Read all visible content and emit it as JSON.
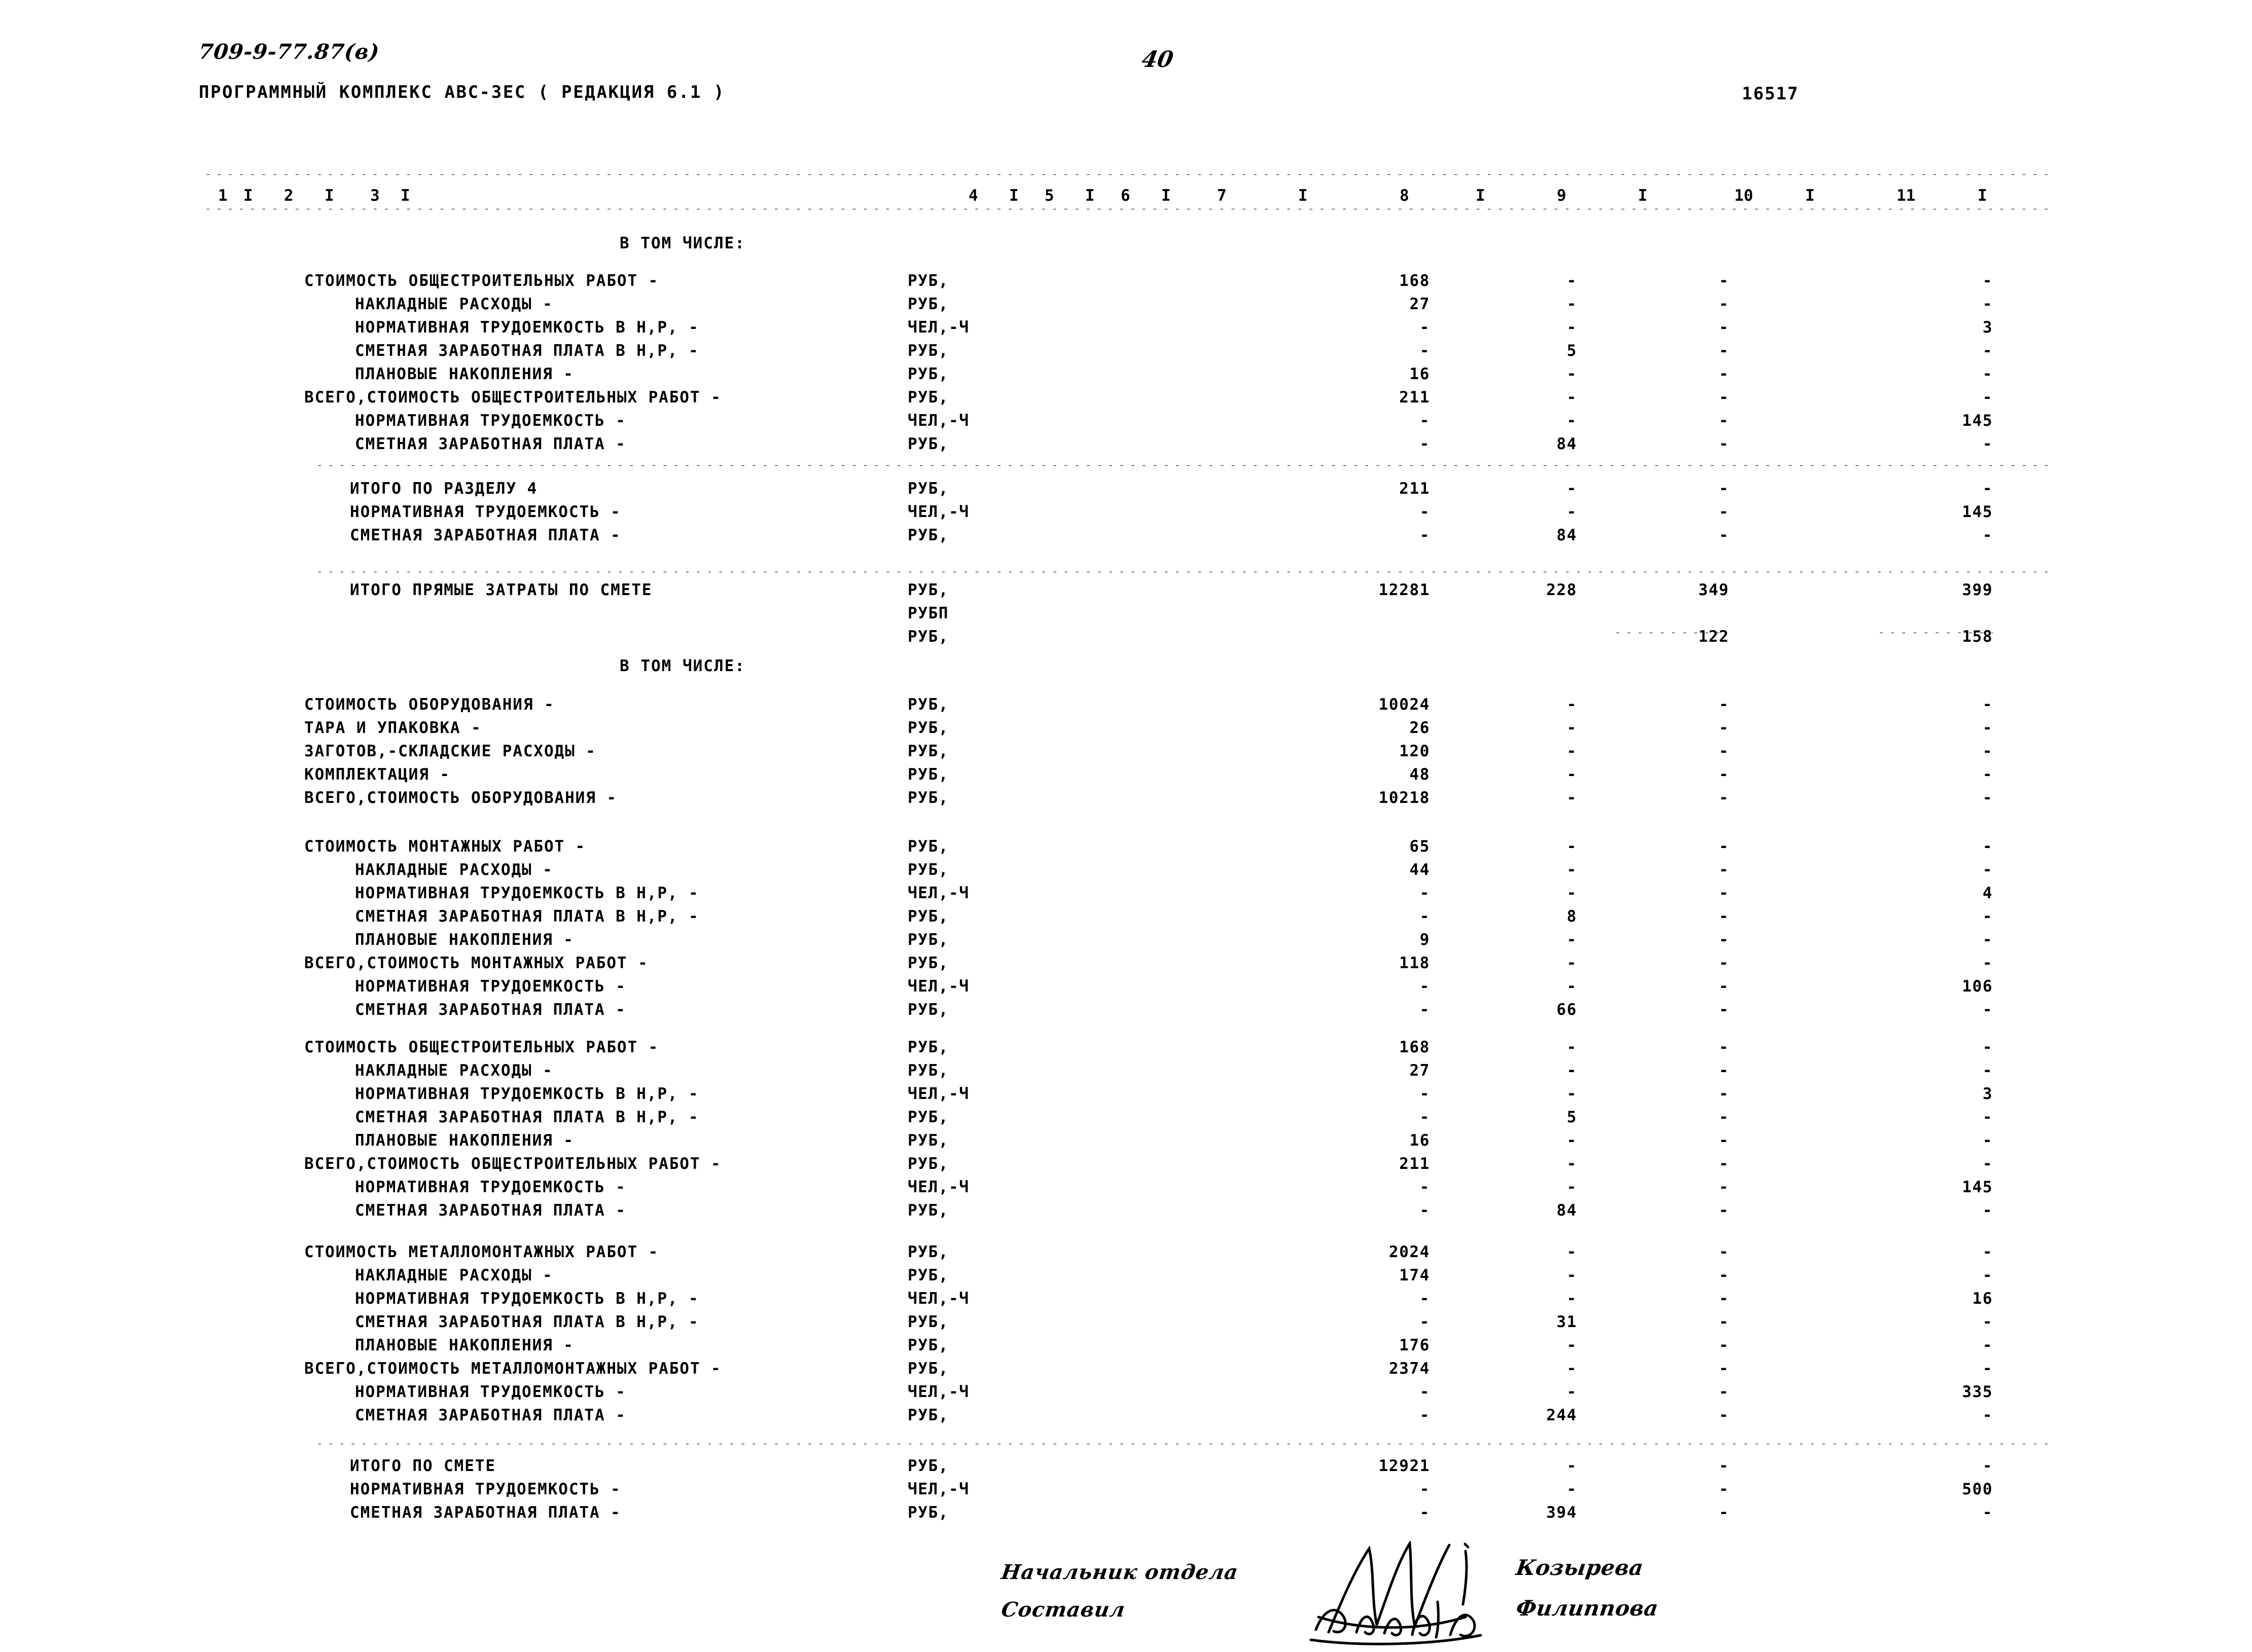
{
  "header": {
    "doc_code": "709-9-77.87(в)",
    "program_line": "ПРОГРАММНЫЙ КОМПЛЕКС АВС-ЗЕС    ( РЕДАКЦИЯ  6.1 )",
    "page_number": "40",
    "doc_id": "16517"
  },
  "column_header": {
    "numbers": [
      "1",
      "2",
      "3",
      "4",
      "5",
      "6",
      "7",
      "8",
      "9",
      "10",
      "11"
    ],
    "separator": "I"
  },
  "section_titles": {
    "in_that_number_1": "В ТОМ ЧИСЛЕ:",
    "in_that_number_2": "В ТОМ ЧИСЛЕ:"
  },
  "units": {
    "rub": "РУБ,",
    "chel_ch": "ЧЕЛ,-Ч"
  },
  "dash": "-",
  "rows": [
    {
      "label": "СТОИМОСТЬ ОБЩЕСТРОИТЕЛЬНЫХ РАБОТ -",
      "indent": 0,
      "unit": "РУБ,",
      "c7": "168",
      "c8": "-",
      "c9": "-",
      "c10": "",
      "c11": "-"
    },
    {
      "label": "НАКЛАДНЫЕ РАСХОДЫ -",
      "indent": 1,
      "unit": "РУБ,",
      "c7": "27",
      "c8": "-",
      "c9": "-",
      "c10": "",
      "c11": "-"
    },
    {
      "label": "НОРМАТИВНАЯ ТРУДОЕМКОСТЬ В Н,Р, -",
      "indent": 1,
      "unit": "ЧЕЛ,-Ч",
      "c7": "-",
      "c8": "-",
      "c9": "-",
      "c10": "",
      "c11": "3"
    },
    {
      "label": "СМЕТНАЯ ЗАРАБОТНАЯ ПЛАТА В Н,Р, -",
      "indent": 1,
      "unit": "РУБ,",
      "c7": "-",
      "c8": "5",
      "c9": "-",
      "c10": "",
      "c11": "-"
    },
    {
      "label": "ПЛАНОВЫЕ НАКОПЛЕНИЯ -",
      "indent": 1,
      "unit": "РУБ,",
      "c7": "16",
      "c8": "-",
      "c9": "-",
      "c10": "",
      "c11": "-"
    },
    {
      "label": "ВСЕГО,СТОИМОСТЬ ОБЩЕСТРОИТЕЛЬНЫХ РАБОТ -",
      "indent": 0,
      "unit": "РУБ,",
      "c7": "211",
      "c8": "-",
      "c9": "-",
      "c10": "",
      "c11": "-"
    },
    {
      "label": "НОРМАТИВНАЯ ТРУДОЕМКОСТЬ -",
      "indent": 1,
      "unit": "ЧЕЛ,-Ч",
      "c7": "-",
      "c8": "-",
      "c9": "-",
      "c10": "",
      "c11": "145"
    },
    {
      "label": "СМЕТНАЯ ЗАРАБОТНАЯ ПЛАТА -",
      "indent": 1,
      "unit": "РУБ,",
      "c7": "-",
      "c8": "84",
      "c9": "-",
      "c10": "",
      "c11": "-"
    }
  ],
  "razdel_rows": [
    {
      "label": "ИТОГО ПО РАЗДЕЛУ     4",
      "indent": 2,
      "unit": "РУБ,",
      "c7": "211",
      "c8": "-",
      "c9": "-",
      "c10": "",
      "c11": "-"
    },
    {
      "label": "НОРМАТИВНАЯ ТРУДОЕМКОСТЬ -",
      "indent": 2,
      "unit": "ЧЕЛ,-Ч",
      "c7": "-",
      "c8": "-",
      "c9": "-",
      "c10": "",
      "c11": "145"
    },
    {
      "label": "СМЕТНАЯ ЗАРАБОТНАЯ ПЛАТА -",
      "indent": 2,
      "unit": "РУБ,",
      "c7": "-",
      "c8": "84",
      "c9": "-",
      "c10": "",
      "c11": "-"
    }
  ],
  "direct_cost_rows": [
    {
      "label": "ИТОГО ПРЯМЫЕ ЗАТРАТЫ ПО СМЕТЕ",
      "indent": 2,
      "unit": "РУБ,",
      "c7": "12281",
      "c8": "228",
      "c9": "349",
      "c10": "",
      "c11": "399"
    },
    {
      "label": "",
      "indent": 2,
      "unit": "РУБП",
      "c7": "",
      "c8": "",
      "c9": "",
      "c10": "",
      "c11": ""
    },
    {
      "label": "",
      "indent": 2,
      "unit": "РУБ,",
      "c7": "",
      "c8": "",
      "c9": "122",
      "c10": "",
      "c11": "158"
    }
  ],
  "equipment_rows": [
    {
      "label": "СТОИМОСТЬ ОБОРУДОВАНИЯ -",
      "indent": 0,
      "unit": "РУБ,",
      "c7": "10024",
      "c8": "-",
      "c9": "-",
      "c10": "",
      "c11": "-"
    },
    {
      "label": "ТАРА И УПАКОВКА -",
      "indent": 0,
      "unit": "РУБ,",
      "c7": "26",
      "c8": "-",
      "c9": "-",
      "c10": "",
      "c11": "-"
    },
    {
      "label": "ЗАГОТОВ,-СКЛАДСКИЕ РАСХОДЫ -",
      "indent": 0,
      "unit": "РУБ,",
      "c7": "120",
      "c8": "-",
      "c9": "-",
      "c10": "",
      "c11": "-"
    },
    {
      "label": "КОМПЛЕКТАЦИЯ -",
      "indent": 0,
      "unit": "РУБ,",
      "c7": "48",
      "c8": "-",
      "c9": "-",
      "c10": "",
      "c11": "-"
    },
    {
      "label": "ВСЕГО,СТОИМОСТЬ ОБОРУДОВАНИЯ -",
      "indent": 0,
      "unit": "РУБ,",
      "c7": "10218",
      "c8": "-",
      "c9": "-",
      "c10": "",
      "c11": "-"
    }
  ],
  "montage_rows": [
    {
      "label": "СТОИМОСТЬ МОНТАЖНЫХ РАБОТ -",
      "indent": 0,
      "unit": "РУБ,",
      "c7": "65",
      "c8": "-",
      "c9": "-",
      "c10": "",
      "c11": "-"
    },
    {
      "label": "НАКЛАДНЫЕ РАСХОДЫ -",
      "indent": 1,
      "unit": "РУБ,",
      "c7": "44",
      "c8": "-",
      "c9": "-",
      "c10": "",
      "c11": "-"
    },
    {
      "label": "НОРМАТИВНАЯ ТРУДОЕМКОСТЬ В Н,Р, -",
      "indent": 1,
      "unit": "ЧЕЛ,-Ч",
      "c7": "-",
      "c8": "-",
      "c9": "-",
      "c10": "",
      "c11": "4"
    },
    {
      "label": "СМЕТНАЯ ЗАРАБОТНАЯ ПЛАТА В Н,Р, -",
      "indent": 1,
      "unit": "РУБ,",
      "c7": "-",
      "c8": "8",
      "c9": "-",
      "c10": "",
      "c11": "-"
    },
    {
      "label": "ПЛАНОВЫЕ НАКОПЛЕНИЯ -",
      "indent": 1,
      "unit": "РУБ,",
      "c7": "9",
      "c8": "-",
      "c9": "-",
      "c10": "",
      "c11": "-"
    },
    {
      "label": "ВСЕГО,СТОИМОСТЬ МОНТАЖНЫХ РАБОТ -",
      "indent": 0,
      "unit": "РУБ,",
      "c7": "118",
      "c8": "-",
      "c9": "-",
      "c10": "",
      "c11": "-"
    },
    {
      "label": "НОРМАТИВНАЯ ТРУДОЕМКОСТЬ -",
      "indent": 1,
      "unit": "ЧЕЛ,-Ч",
      "c7": "-",
      "c8": "-",
      "c9": "-",
      "c10": "",
      "c11": "106"
    },
    {
      "label": "СМЕТНАЯ ЗАРАБОТНАЯ ПЛАТА -",
      "indent": 1,
      "unit": "РУБ,",
      "c7": "-",
      "c8": "66",
      "c9": "-",
      "c10": "",
      "c11": "-"
    }
  ],
  "general_build_rows": [
    {
      "label": "СТОИМОСТЬ ОБЩЕСТРОИТЕЛЬНЫХ РАБОТ -",
      "indent": 0,
      "unit": "РУБ,",
      "c7": "168",
      "c8": "-",
      "c9": "-",
      "c10": "",
      "c11": "-"
    },
    {
      "label": "НАКЛАДНЫЕ РАСХОДЫ -",
      "indent": 1,
      "unit": "РУБ,",
      "c7": "27",
      "c8": "-",
      "c9": "-",
      "c10": "",
      "c11": "-"
    },
    {
      "label": "НОРМАТИВНАЯ ТРУДОЕМКОСТЬ В Н,Р, -",
      "indent": 1,
      "unit": "ЧЕЛ,-Ч",
      "c7": "-",
      "c8": "-",
      "c9": "-",
      "c10": "",
      "c11": "3"
    },
    {
      "label": "СМЕТНАЯ ЗАРАБОТНАЯ ПЛАТА В Н,Р, -",
      "indent": 1,
      "unit": "РУБ,",
      "c7": "-",
      "c8": "5",
      "c9": "-",
      "c10": "",
      "c11": "-"
    },
    {
      "label": "ПЛАНОВЫЕ НАКОПЛЕНИЯ -",
      "indent": 1,
      "unit": "РУБ,",
      "c7": "16",
      "c8": "-",
      "c9": "-",
      "c10": "",
      "c11": "-"
    },
    {
      "label": "ВСЕГО,СТОИМОСТЬ ОБЩЕСТРОИТЕЛЬНЫХ РАБОТ -",
      "indent": 0,
      "unit": "РУБ,",
      "c7": "211",
      "c8": "-",
      "c9": "-",
      "c10": "",
      "c11": "-"
    },
    {
      "label": "НОРМАТИВНАЯ ТРУДОЕМКОСТЬ -",
      "indent": 1,
      "unit": "ЧЕЛ,-Ч",
      "c7": "-",
      "c8": "-",
      "c9": "-",
      "c10": "",
      "c11": "145"
    },
    {
      "label": "СМЕТНАЯ ЗАРАБОТНАЯ ПЛАТА -",
      "indent": 1,
      "unit": "РУБ,",
      "c7": "-",
      "c8": "84",
      "c9": "-",
      "c10": "",
      "c11": "-"
    }
  ],
  "metal_rows": [
    {
      "label": "СТОИМОСТЬ МЕТАЛЛОМОНТАЖНЫХ РАБОТ -",
      "indent": 0,
      "unit": "РУБ,",
      "c7": "2024",
      "c8": "-",
      "c9": "-",
      "c10": "",
      "c11": "-"
    },
    {
      "label": "НАКЛАДНЫЕ РАСХОДЫ -",
      "indent": 1,
      "unit": "РУБ,",
      "c7": "174",
      "c8": "-",
      "c9": "-",
      "c10": "",
      "c11": "-"
    },
    {
      "label": "НОРМАТИВНАЯ ТРУДОЕМКОСТЬ В Н,Р, -",
      "indent": 1,
      "unit": "ЧЕЛ,-Ч",
      "c7": "-",
      "c8": "-",
      "c9": "-",
      "c10": "",
      "c11": "16"
    },
    {
      "label": "СМЕТНАЯ ЗАРАБОТНАЯ ПЛАТА В Н,Р, -",
      "indent": 1,
      "unit": "РУБ,",
      "c7": "-",
      "c8": "31",
      "c9": "-",
      "c10": "",
      "c11": "-"
    },
    {
      "label": "ПЛАНОВЫЕ НАКОПЛЕНИЯ -",
      "indent": 1,
      "unit": "РУБ,",
      "c7": "176",
      "c8": "-",
      "c9": "-",
      "c10": "",
      "c11": "-"
    },
    {
      "label": "ВСЕГО,СТОИМОСТЬ МЕТАЛЛОМОНТАЖНЫХ РАБОТ -",
      "indent": 0,
      "unit": "РУБ,",
      "c7": "2374",
      "c8": "-",
      "c9": "-",
      "c10": "",
      "c11": "-"
    },
    {
      "label": "НОРМАТИВНАЯ ТРУДОЕМКОСТЬ -",
      "indent": 1,
      "unit": "ЧЕЛ,-Ч",
      "c7": "-",
      "c8": "-",
      "c9": "-",
      "c10": "",
      "c11": "335"
    },
    {
      "label": "СМЕТНАЯ ЗАРАБОТНАЯ ПЛАТА -",
      "indent": 1,
      "unit": "РУБ,",
      "c7": "-",
      "c8": "244",
      "c9": "-",
      "c10": "",
      "c11": "-"
    }
  ],
  "total_rows": [
    {
      "label": "ИТОГО ПО СМЕТЕ",
      "indent": 2,
      "unit": "РУБ,",
      "c7": "12921",
      "c8": "-",
      "c9": "-",
      "c10": "",
      "c11": "-"
    },
    {
      "label": "НОРМАТИВНАЯ ТРУДОЕМКОСТЬ -",
      "indent": 2,
      "unit": "ЧЕЛ,-Ч",
      "c7": "-",
      "c8": "-",
      "c9": "-",
      "c10": "",
      "c11": "500"
    },
    {
      "label": "СМЕТНАЯ ЗАРАБОТНАЯ ПЛАТА -",
      "indent": 2,
      "unit": "РУБ,",
      "c7": "-",
      "c8": "394",
      "c9": "-",
      "c10": "",
      "c11": "-"
    }
  ],
  "signatures": {
    "role_1": "Начальник  отдела",
    "role_2": "Составил",
    "name_1": "Козырева",
    "name_2": "Филиппова"
  }
}
